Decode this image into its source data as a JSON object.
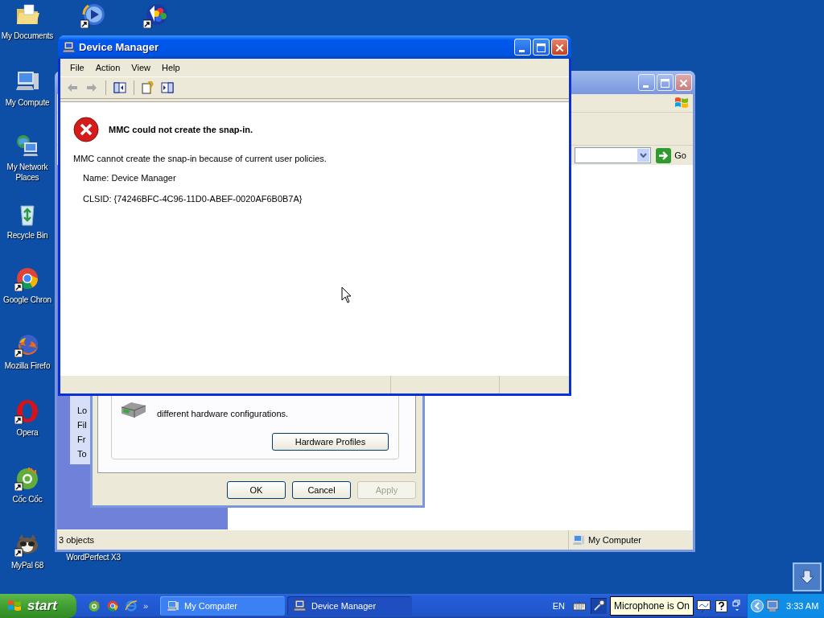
{
  "desktop_icons": [
    {
      "label": "My Documents",
      "kind": "folder",
      "shortcut": false
    },
    {
      "label": "My Compute",
      "kind": "computer",
      "shortcut": false
    },
    {
      "label": "My Network Places",
      "kind": "network",
      "shortcut": false
    },
    {
      "label": "Recycle Bin",
      "kind": "recycle",
      "shortcut": false
    },
    {
      "label": "Google Chron",
      "kind": "chrome",
      "shortcut": true
    },
    {
      "label": "Mozilla Firefo",
      "kind": "firefox",
      "shortcut": true
    },
    {
      "label": "Opera",
      "kind": "opera",
      "shortcut": true
    },
    {
      "label": "Cốc Cốc",
      "kind": "coccoc",
      "shortcut": true
    },
    {
      "label": "MyPal 68",
      "kind": "mypal",
      "shortcut": true
    }
  ],
  "top_icons": [
    {
      "kind": "media",
      "shortcut": true
    },
    {
      "kind": "wordperfect",
      "shortcut": true
    }
  ],
  "covered_icon": {
    "label": "WordPerfect X3"
  },
  "explorer": {
    "go_button": "Go",
    "task_pane": [
      "Lo",
      "Fil",
      "Fr",
      "To"
    ],
    "status": "3 objects",
    "status_location": "My Computer"
  },
  "system_properties": {
    "description": "different hardware configurations.",
    "profiles_button": "Hardware Profiles",
    "buttons": [
      {
        "label": "OK",
        "disabled": false
      },
      {
        "label": "Cancel",
        "disabled": false
      },
      {
        "label": "Apply",
        "disabled": true
      }
    ]
  },
  "device_manager": {
    "title": "Device Manager",
    "menu": [
      "File",
      "Action",
      "View",
      "Help"
    ],
    "toolbar": [
      {
        "kind": "back",
        "disabled": true
      },
      {
        "kind": "forward",
        "disabled": true
      },
      {
        "kind": "separator"
      },
      {
        "kind": "console-tree",
        "disabled": false
      },
      {
        "kind": "separator"
      },
      {
        "kind": "help",
        "disabled": false
      },
      {
        "kind": "action-pane",
        "disabled": false
      }
    ],
    "error": {
      "title": "MMC could not create the snap-in.",
      "message": "MMC cannot create the snap-in because of current user policies.",
      "name": "Name: Device Manager",
      "clsid": "CLSID: {74246BFC-4C96-11D0-ABEF-0020AF6B0B7A}"
    }
  },
  "taskbar": {
    "start": "start",
    "quick_launch": [
      {
        "kind": "coccoc"
      },
      {
        "kind": "chrome"
      },
      {
        "kind": "ie"
      }
    ],
    "chevron": "»",
    "tasks": [
      {
        "label": "My Computer",
        "kind": "computer",
        "selected": false
      },
      {
        "label": "Device Manager",
        "kind": "devmgr",
        "selected": true
      }
    ],
    "language": "EN",
    "tooltip": "Microphone is On",
    "clock": "3:33 AM"
  }
}
